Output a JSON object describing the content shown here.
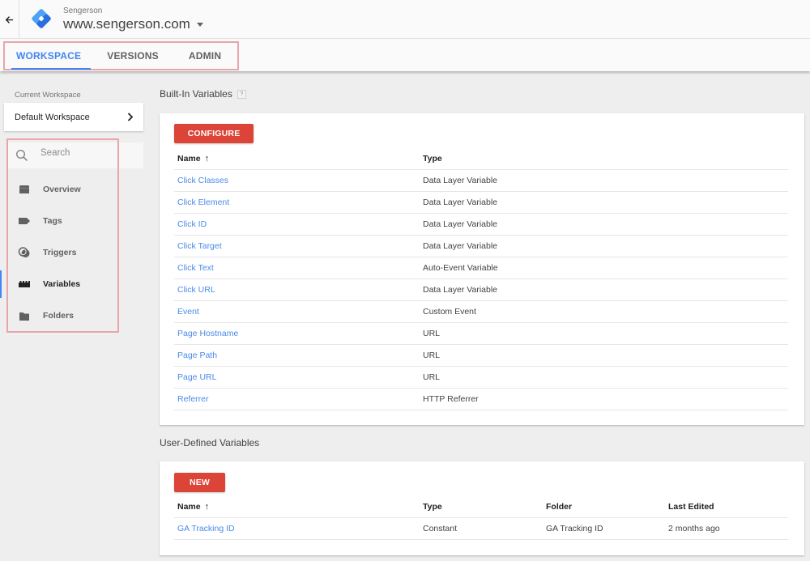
{
  "header": {
    "account_name": "Sengerson",
    "container_name": "www.sengerson.com",
    "tabs": [
      {
        "label": "WORKSPACE",
        "active": true
      },
      {
        "label": "VERSIONS",
        "active": false
      },
      {
        "label": "ADMIN",
        "active": false
      }
    ],
    "accent_color": "#4285f4"
  },
  "sidebar": {
    "current_workspace_label": "Current Workspace",
    "workspace_name": "Default Workspace",
    "search": {
      "placeholder": "Search",
      "value": ""
    },
    "items": [
      {
        "label": "Overview",
        "icon": "overview-icon",
        "active": false
      },
      {
        "label": "Tags",
        "icon": "tag-icon",
        "active": false
      },
      {
        "label": "Triggers",
        "icon": "trigger-icon",
        "active": false
      },
      {
        "label": "Variables",
        "icon": "variables-icon",
        "active": true
      },
      {
        "label": "Folders",
        "icon": "folder-icon",
        "active": false
      }
    ]
  },
  "built_in": {
    "title": "Built-In Variables",
    "help_label": "?",
    "configure_label": "CONFIGURE",
    "columns": {
      "name": "Name",
      "type": "Type",
      "sort_indicator": "↑"
    },
    "rows": [
      {
        "name": "Click Classes",
        "type": "Data Layer Variable"
      },
      {
        "name": "Click Element",
        "type": "Data Layer Variable"
      },
      {
        "name": "Click ID",
        "type": "Data Layer Variable"
      },
      {
        "name": "Click Target",
        "type": "Data Layer Variable"
      },
      {
        "name": "Click Text",
        "type": "Auto-Event Variable"
      },
      {
        "name": "Click URL",
        "type": "Data Layer Variable"
      },
      {
        "name": "Event",
        "type": "Custom Event"
      },
      {
        "name": "Page Hostname",
        "type": "URL"
      },
      {
        "name": "Page Path",
        "type": "URL"
      },
      {
        "name": "Page URL",
        "type": "URL"
      },
      {
        "name": "Referrer",
        "type": "HTTP Referrer"
      }
    ]
  },
  "user_defined": {
    "title": "User-Defined Variables",
    "new_label": "NEW",
    "columns": {
      "name": "Name",
      "type": "Type",
      "folder": "Folder",
      "last_edited": "Last Edited",
      "sort_indicator": "↑"
    },
    "rows": [
      {
        "name": "GA Tracking ID",
        "type": "Constant",
        "folder": "GA Tracking ID",
        "last_edited": "2 months ago"
      }
    ]
  },
  "colors": {
    "button": "#db4437",
    "link": "#4a8ae8",
    "highlight_box": "#e8a6aa"
  }
}
